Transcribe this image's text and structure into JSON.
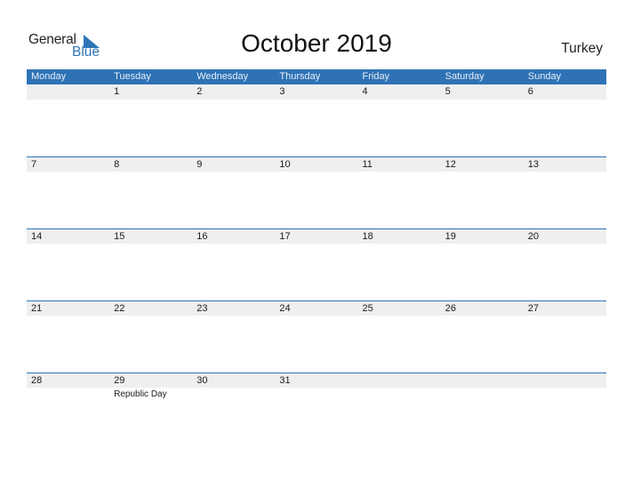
{
  "logo": {
    "word1": "General",
    "word2": "Blue",
    "icon": "triangle-flag-icon"
  },
  "title": "October 2019",
  "country": "Turkey",
  "colors": {
    "header_bg": "#2e72b5",
    "accent": "#2e75b6",
    "row_bg": "#efefef"
  },
  "weekdays": [
    "Monday",
    "Tuesday",
    "Wednesday",
    "Thursday",
    "Friday",
    "Saturday",
    "Sunday"
  ],
  "weeks": [
    {
      "days": [
        "",
        "1",
        "2",
        "3",
        "4",
        "5",
        "6"
      ],
      "events": [
        "",
        "",
        "",
        "",
        "",
        "",
        ""
      ]
    },
    {
      "days": [
        "7",
        "8",
        "9",
        "10",
        "11",
        "12",
        "13"
      ],
      "events": [
        "",
        "",
        "",
        "",
        "",
        "",
        ""
      ]
    },
    {
      "days": [
        "14",
        "15",
        "16",
        "17",
        "18",
        "19",
        "20"
      ],
      "events": [
        "",
        "",
        "",
        "",
        "",
        "",
        ""
      ]
    },
    {
      "days": [
        "21",
        "22",
        "23",
        "24",
        "25",
        "26",
        "27"
      ],
      "events": [
        "",
        "",
        "",
        "",
        "",
        "",
        ""
      ]
    },
    {
      "days": [
        "28",
        "29",
        "30",
        "31",
        "",
        "",
        ""
      ],
      "events": [
        "",
        "Republic Day",
        "",
        "",
        "",
        "",
        ""
      ]
    }
  ]
}
